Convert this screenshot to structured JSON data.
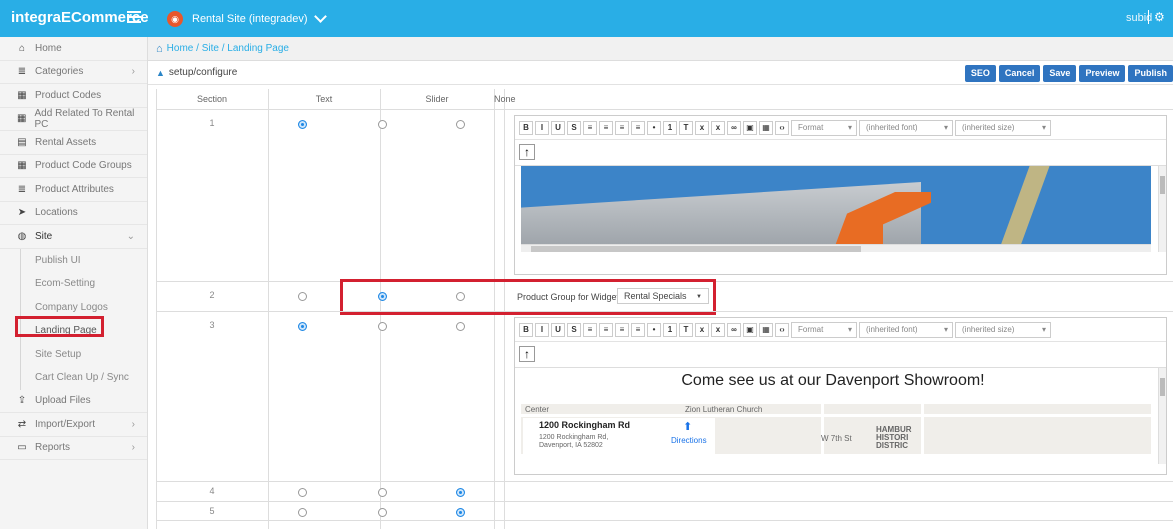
{
  "app": {
    "brand": "integraECommerce",
    "site": "Rental Site (integradev)",
    "user": "subid"
  },
  "sidebar": {
    "items": [
      {
        "label": "Home",
        "icon": "home-icon"
      },
      {
        "label": "Categories",
        "icon": "list-icon"
      },
      {
        "label": "Product Codes",
        "icon": "grid-icon"
      },
      {
        "label": "Add Related To Rental PC",
        "icon": "grid-icon"
      },
      {
        "label": "Rental Assets",
        "icon": "table-icon"
      },
      {
        "label": "Product Code Groups",
        "icon": "grid-icon"
      },
      {
        "label": "Product Attributes",
        "icon": "list-icon"
      },
      {
        "label": "Locations",
        "icon": "location-icon"
      },
      {
        "label": "Site",
        "icon": "globe-icon"
      }
    ],
    "site_children": [
      "Publish UI",
      "Ecom-Setting",
      "Company Logos",
      "Landing Page",
      "Site Setup",
      "Cart Clean Up / Sync"
    ],
    "bottom_items": [
      {
        "label": "Upload Files",
        "icon": "upload-icon"
      },
      {
        "label": "Import/Export",
        "icon": "exchange-icon"
      },
      {
        "label": "Reports",
        "icon": "report-icon"
      }
    ]
  },
  "breadcrumb": {
    "home": "Home",
    "site": "Site",
    "page": "Landing Page"
  },
  "setup": {
    "label": "setup/configure"
  },
  "actions": [
    "SEO",
    "Cancel",
    "Save",
    "Preview",
    "Publish"
  ],
  "grid": {
    "headers": [
      "Section",
      "Text",
      "Slider",
      "None"
    ],
    "rows": [
      {
        "section": "1",
        "selected": "text"
      },
      {
        "section": "2",
        "selected": "slider"
      },
      {
        "section": "3",
        "selected": "text"
      },
      {
        "section": "4",
        "selected": "none"
      },
      {
        "section": "5",
        "selected": "none"
      }
    ]
  },
  "editor": {
    "format_label": "Format",
    "font_label": "(inherited font)",
    "size_label": "(inherited size)"
  },
  "widget": {
    "label": "Product Group for Widget :",
    "value": "Rental Specials"
  },
  "showroom": {
    "title": "Come see us at our Davenport Showroom!",
    "address_line1": "1200 Rockingham Rd",
    "address_line2": "1200 Rockingham Rd, Davenport, IA 52802",
    "directions": "Directions",
    "map_labels": [
      "Zion Lutheran Church",
      "HAMBUR HISTORI DISTRIC",
      "W 7th St",
      "Center"
    ]
  },
  "colors": {
    "topbar": "#29aee6",
    "button": "#2f74c0",
    "highlight": "#d32030",
    "radio": "#1e88e5"
  }
}
